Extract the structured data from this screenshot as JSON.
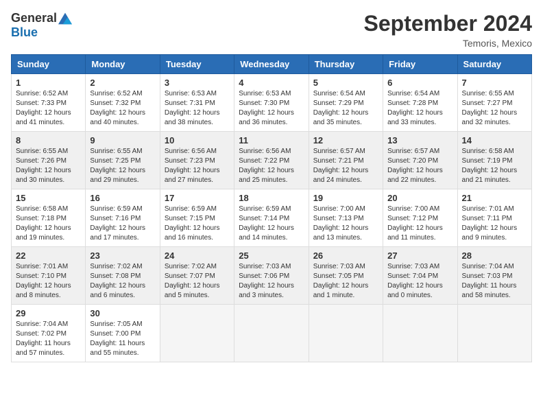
{
  "logo": {
    "general": "General",
    "blue": "Blue"
  },
  "title": "September 2024",
  "location": "Temoris, Mexico",
  "days_of_week": [
    "Sunday",
    "Monday",
    "Tuesday",
    "Wednesday",
    "Thursday",
    "Friday",
    "Saturday"
  ],
  "weeks": [
    [
      {
        "day": "1",
        "sunrise": "6:52 AM",
        "sunset": "7:33 PM",
        "daylight": "12 hours and 41 minutes."
      },
      {
        "day": "2",
        "sunrise": "6:52 AM",
        "sunset": "7:32 PM",
        "daylight": "12 hours and 40 minutes."
      },
      {
        "day": "3",
        "sunrise": "6:53 AM",
        "sunset": "7:31 PM",
        "daylight": "12 hours and 38 minutes."
      },
      {
        "day": "4",
        "sunrise": "6:53 AM",
        "sunset": "7:30 PM",
        "daylight": "12 hours and 36 minutes."
      },
      {
        "day": "5",
        "sunrise": "6:54 AM",
        "sunset": "7:29 PM",
        "daylight": "12 hours and 35 minutes."
      },
      {
        "day": "6",
        "sunrise": "6:54 AM",
        "sunset": "7:28 PM",
        "daylight": "12 hours and 33 minutes."
      },
      {
        "day": "7",
        "sunrise": "6:55 AM",
        "sunset": "7:27 PM",
        "daylight": "12 hours and 32 minutes."
      }
    ],
    [
      {
        "day": "8",
        "sunrise": "6:55 AM",
        "sunset": "7:26 PM",
        "daylight": "12 hours and 30 minutes."
      },
      {
        "day": "9",
        "sunrise": "6:55 AM",
        "sunset": "7:25 PM",
        "daylight": "12 hours and 29 minutes."
      },
      {
        "day": "10",
        "sunrise": "6:56 AM",
        "sunset": "7:23 PM",
        "daylight": "12 hours and 27 minutes."
      },
      {
        "day": "11",
        "sunrise": "6:56 AM",
        "sunset": "7:22 PM",
        "daylight": "12 hours and 25 minutes."
      },
      {
        "day": "12",
        "sunrise": "6:57 AM",
        "sunset": "7:21 PM",
        "daylight": "12 hours and 24 minutes."
      },
      {
        "day": "13",
        "sunrise": "6:57 AM",
        "sunset": "7:20 PM",
        "daylight": "12 hours and 22 minutes."
      },
      {
        "day": "14",
        "sunrise": "6:58 AM",
        "sunset": "7:19 PM",
        "daylight": "12 hours and 21 minutes."
      }
    ],
    [
      {
        "day": "15",
        "sunrise": "6:58 AM",
        "sunset": "7:18 PM",
        "daylight": "12 hours and 19 minutes."
      },
      {
        "day": "16",
        "sunrise": "6:59 AM",
        "sunset": "7:16 PM",
        "daylight": "12 hours and 17 minutes."
      },
      {
        "day": "17",
        "sunrise": "6:59 AM",
        "sunset": "7:15 PM",
        "daylight": "12 hours and 16 minutes."
      },
      {
        "day": "18",
        "sunrise": "6:59 AM",
        "sunset": "7:14 PM",
        "daylight": "12 hours and 14 minutes."
      },
      {
        "day": "19",
        "sunrise": "7:00 AM",
        "sunset": "7:13 PM",
        "daylight": "12 hours and 13 minutes."
      },
      {
        "day": "20",
        "sunrise": "7:00 AM",
        "sunset": "7:12 PM",
        "daylight": "12 hours and 11 minutes."
      },
      {
        "day": "21",
        "sunrise": "7:01 AM",
        "sunset": "7:11 PM",
        "daylight": "12 hours and 9 minutes."
      }
    ],
    [
      {
        "day": "22",
        "sunrise": "7:01 AM",
        "sunset": "7:10 PM",
        "daylight": "12 hours and 8 minutes."
      },
      {
        "day": "23",
        "sunrise": "7:02 AM",
        "sunset": "7:08 PM",
        "daylight": "12 hours and 6 minutes."
      },
      {
        "day": "24",
        "sunrise": "7:02 AM",
        "sunset": "7:07 PM",
        "daylight": "12 hours and 5 minutes."
      },
      {
        "day": "25",
        "sunrise": "7:03 AM",
        "sunset": "7:06 PM",
        "daylight": "12 hours and 3 minutes."
      },
      {
        "day": "26",
        "sunrise": "7:03 AM",
        "sunset": "7:05 PM",
        "daylight": "12 hours and 1 minute."
      },
      {
        "day": "27",
        "sunrise": "7:03 AM",
        "sunset": "7:04 PM",
        "daylight": "12 hours and 0 minutes."
      },
      {
        "day": "28",
        "sunrise": "7:04 AM",
        "sunset": "7:03 PM",
        "daylight": "11 hours and 58 minutes."
      }
    ],
    [
      {
        "day": "29",
        "sunrise": "7:04 AM",
        "sunset": "7:02 PM",
        "daylight": "11 hours and 57 minutes."
      },
      {
        "day": "30",
        "sunrise": "7:05 AM",
        "sunset": "7:00 PM",
        "daylight": "11 hours and 55 minutes."
      },
      null,
      null,
      null,
      null,
      null
    ]
  ]
}
